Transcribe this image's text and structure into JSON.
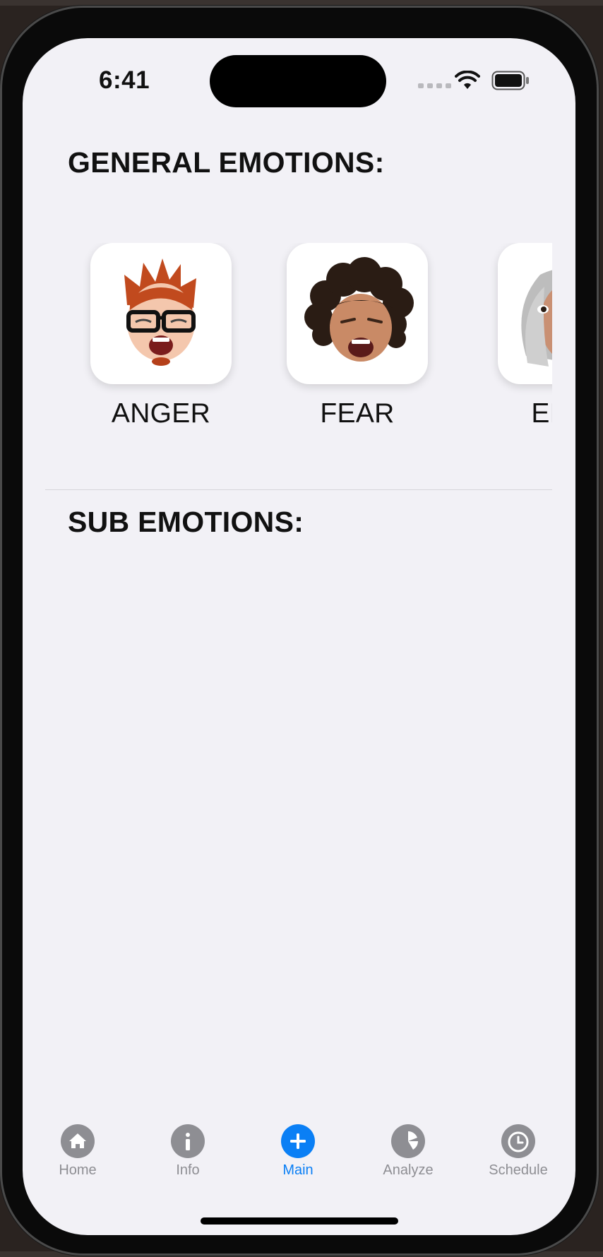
{
  "status_bar": {
    "time": "6:41"
  },
  "general": {
    "title": "GENERAL EMOTIONS:",
    "emotions": [
      {
        "label": "ANGER",
        "avatar": "red-spiky-hair-glasses-memoji"
      },
      {
        "label": "FEAR",
        "avatar": "curly-hair-memoji"
      },
      {
        "label": "ENJOYMENT",
        "visible_label": "ENJO",
        "avatar": "gray-hair-memoji"
      }
    ]
  },
  "sub": {
    "title": "SUB EMOTIONS:"
  },
  "tabs": [
    {
      "label": "Home",
      "icon": "house-icon"
    },
    {
      "label": "Info",
      "icon": "info-icon"
    },
    {
      "label": "Main",
      "icon": "plus-icon",
      "active": true
    },
    {
      "label": "Analyze",
      "icon": "pie-chart-icon"
    },
    {
      "label": "Schedule",
      "icon": "alarm-clock-icon"
    }
  ],
  "colors": {
    "accent": "#0a7ff5",
    "inactive": "#8e8e93",
    "background": "#f2f1f6"
  }
}
